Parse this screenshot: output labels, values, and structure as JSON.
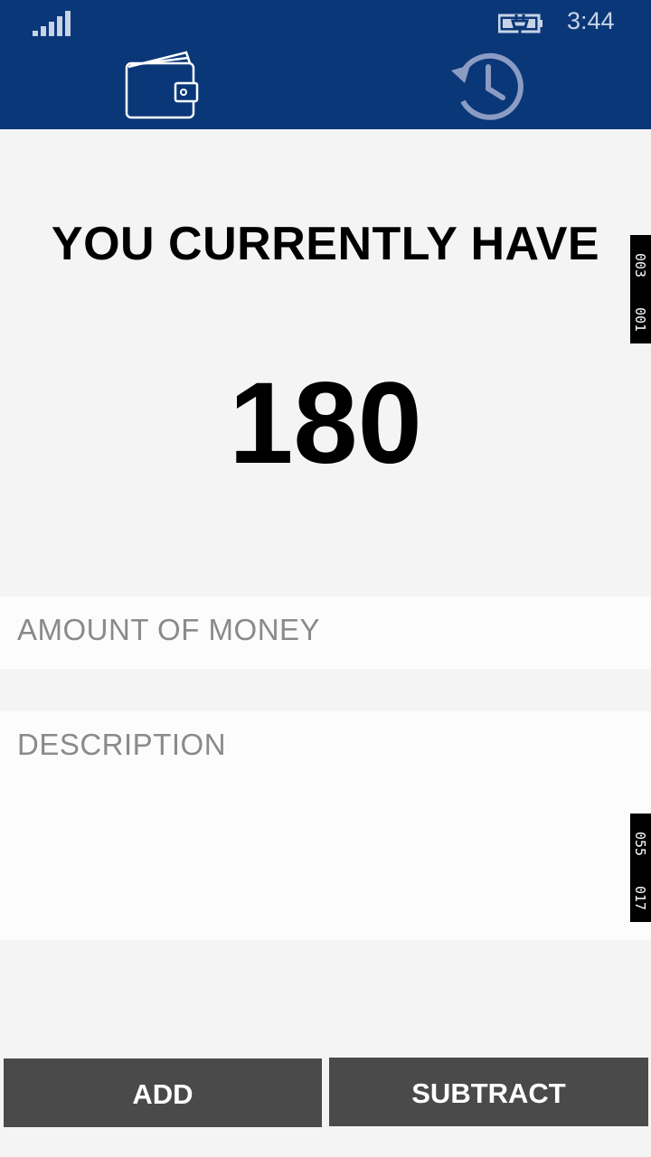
{
  "status_bar": {
    "time": "3:44",
    "signal_icon": "signal-bars-icon",
    "battery_icon": "battery-charging-icon"
  },
  "nav": {
    "wallet_icon": "wallet-icon",
    "history_icon": "history-icon"
  },
  "main": {
    "headline": "YOU CURRENTLY HAVE",
    "balance": "180"
  },
  "form": {
    "amount_placeholder": "AMOUNT OF MONEY",
    "description_placeholder": "DESCRIPTION"
  },
  "actions": {
    "add_label": "ADD",
    "subtract_label": "SUBTRACT"
  },
  "markers": {
    "top": [
      "003",
      "001"
    ],
    "bottom": [
      "055",
      "017"
    ]
  },
  "colors": {
    "header": "#0a3778",
    "button": "#4a4a4a",
    "background": "#f4f4f4"
  }
}
